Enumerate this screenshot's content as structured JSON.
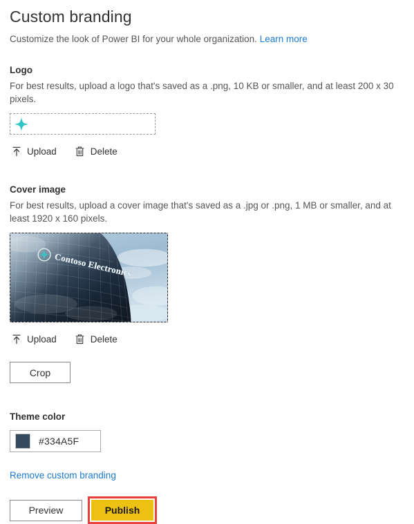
{
  "header": {
    "title": "Custom branding",
    "subtitle": "Customize the look of Power BI for your whole organization.",
    "learn_more": "Learn more"
  },
  "logo": {
    "label": "Logo",
    "description": "For best results, upload a logo that's saved as a .png, 10 KB or smaller, and at least 200 x 30 pixels.",
    "upload_label": "Upload",
    "delete_label": "Delete",
    "logo_color": "#2ec4c6"
  },
  "cover": {
    "label": "Cover image",
    "description": "For best results, upload a cover image that's saved as a .jpg or .png, 1 MB or smaller, and at least 1920 x 160 pixels.",
    "upload_label": "Upload",
    "delete_label": "Delete",
    "crop_label": "Crop",
    "image_alt": "Contoso Electronics glass office building with company signage",
    "signage_text": "Contoso Electronics"
  },
  "theme": {
    "label": "Theme color",
    "value": "#334A5F",
    "swatch_color": "#334A5F"
  },
  "actions": {
    "remove_branding": "Remove custom branding",
    "preview_label": "Preview",
    "publish_label": "Publish",
    "publish_highlight_color": "#e8413c",
    "publish_button_color": "#edc111",
    "link_color": "#1a7ad4"
  }
}
